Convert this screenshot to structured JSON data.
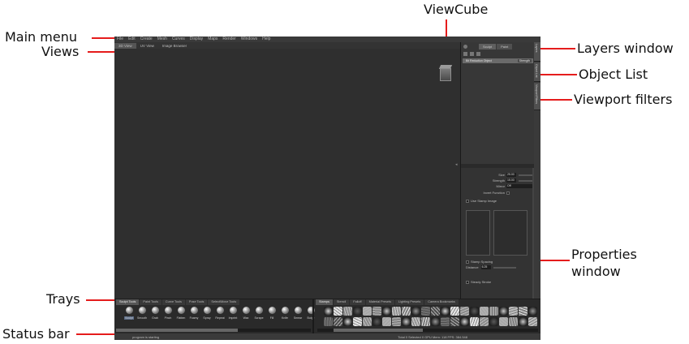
{
  "callouts": {
    "main_menu": "Main menu",
    "views": "Views",
    "viewcube": "ViewCube",
    "layers_window": "Layers window",
    "object_list": "Object List",
    "viewport_filters": "Viewport filters",
    "properties_window_line1": "Properties",
    "properties_window_line2": "window",
    "trays": "Trays",
    "status_bar": "Status bar"
  },
  "menu": [
    "File",
    "Edit",
    "Create",
    "Mesh",
    "Curves",
    "Display",
    "Maps",
    "Render",
    "Windows",
    "Help"
  ],
  "view_tabs": [
    "3D View",
    "UV View",
    "Image Browser"
  ],
  "layers": {
    "tabs": [
      "Sculpt",
      "Paint"
    ],
    "layer_name": "Bit Reduction Object",
    "layer_tag": "Strength"
  },
  "side_tabs": [
    "Layers",
    "Object List",
    "Viewport Filters"
  ],
  "properties": {
    "size_label": "Size",
    "size_value": "25.00",
    "strength_label": "Strength",
    "strength_value": "15.00",
    "mirror_label": "Mirror",
    "mirror_value": "Off",
    "invert_label": "Invert Function",
    "stamp_image_label": "Use Stamp Image",
    "stamp_spacing_label": "Stamp Spacing",
    "distance_label": "Distance",
    "distance_value": "6.25",
    "steady_stroke_label": "Steady Stroke"
  },
  "tray_tabs_left": [
    "Sculpt Tools",
    "Paint Tools",
    "Curve Tools",
    "Pose Tools",
    "Select/Move Tools"
  ],
  "tray_tabs_right": [
    "Stamps",
    "Stencil",
    "Falloff",
    "Material Presets",
    "Lighting Presets",
    "Camera Bookmarks"
  ],
  "sculpt_tools": [
    "Sculpt",
    "Smooth",
    "Grab",
    "Pinch",
    "Flatten",
    "Foamy",
    "Spray",
    "Repeat",
    "Imprint",
    "Wax",
    "Scrape",
    "Fill",
    "Knife",
    "Smear",
    "Bulge"
  ],
  "status": {
    "left": "program is starting",
    "right": "Total 0  Selected 0  GPU Mem: 118  FPS: 384.548"
  },
  "colors": {
    "callout_line": "#e51c1c",
    "app_background": "#2b2b2b",
    "viewport_background": "#2f2f2f"
  }
}
